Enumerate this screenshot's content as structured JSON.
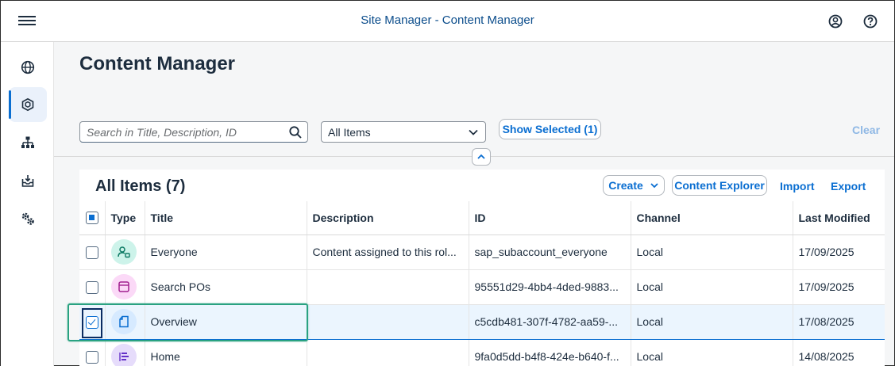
{
  "shell": {
    "title": "Site Manager - Content Manager",
    "menu_icon": "hamburger-menu-icon",
    "profile_icon": "user-profile-icon",
    "help_icon": "help-icon"
  },
  "sidenav": {
    "items": [
      {
        "icon": "globe-icon",
        "active": false
      },
      {
        "icon": "content-cube-icon",
        "active": true
      },
      {
        "icon": "hierarchy-icon",
        "active": false
      },
      {
        "icon": "inbox-download-icon",
        "active": false
      },
      {
        "icon": "settings-gears-icon",
        "active": false
      }
    ]
  },
  "page": {
    "title": "Content Manager"
  },
  "filters": {
    "search_placeholder": "Search in Title, Description, ID",
    "select_value": "All Items",
    "show_selected": "Show Selected (1)",
    "clear": "Clear"
  },
  "panel": {
    "title": "All Items (7)",
    "create": "Create",
    "content_explorer": "Content Explorer",
    "import": "Import",
    "export": "Export"
  },
  "table": {
    "columns": [
      "Type",
      "Title",
      "Description",
      "ID",
      "Channel",
      "Last Modified"
    ],
    "rows": [
      {
        "type_icon": "role-icon",
        "title": "Everyone",
        "description": "Content assigned to this rol...",
        "id": "sap_subaccount_everyone",
        "channel": "Local",
        "modified": "17/09/2025",
        "checked": false
      },
      {
        "type_icon": "app-icon",
        "title": "Search POs",
        "description": "",
        "id": "95551d29-4bb4-4ded-9883...",
        "channel": "Local",
        "modified": "17/09/2025",
        "checked": false
      },
      {
        "type_icon": "page-icon",
        "title": "Overview",
        "description": "",
        "id": "c5cdb481-307f-4782-aa59-...",
        "channel": "Local",
        "modified": "17/08/2025",
        "checked": true
      },
      {
        "type_icon": "workspace-icon",
        "title": "Home",
        "description": "",
        "id": "9fa0d5dd-b4f8-424e-b640-f...",
        "channel": "Local",
        "modified": "14/08/2025",
        "checked": false
      }
    ]
  },
  "colors": {
    "accent": "#0a6ed1",
    "title_blue": "#0a4c8b",
    "highlight": "#2aa281"
  }
}
